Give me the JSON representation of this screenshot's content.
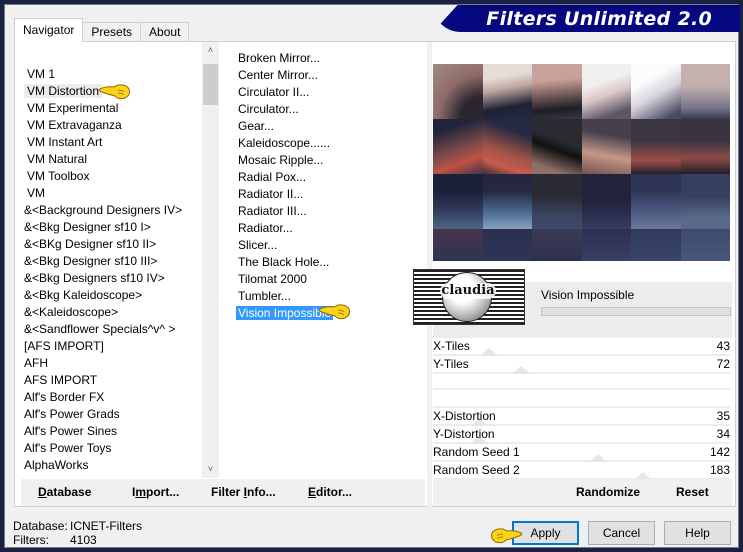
{
  "app": {
    "title": "Filters Unlimited 2.0"
  },
  "tabs": [
    {
      "label": "Navigator",
      "active": true
    },
    {
      "label": "Presets",
      "active": false
    },
    {
      "label": "About",
      "active": false
    }
  ],
  "categories": {
    "selected": "VM Distortion",
    "items": [
      "VM 1",
      "VM Distortion",
      "VM Experimental",
      "VM Extravaganza",
      "VM Instant Art",
      "VM Natural",
      "VM Toolbox",
      "VM",
      "&<Background Designers IV>",
      "&<Bkg Designer sf10 I>",
      "&<BKg Designer sf10 II>",
      "&<Bkg Designer sf10 III>",
      "&<Bkg Designers sf10 IV>",
      "&<Bkg Kaleidoscope>",
      "&<Kaleidoscope>",
      "&<Sandflower Specials^v^ >",
      "[AFS IMPORT]",
      "AFH",
      "AFS IMPORT",
      "Alf's Border FX",
      "Alf's Power Grads",
      "Alf's Power Sines",
      "Alf's Power Toys",
      "AlphaWorks"
    ]
  },
  "filters": {
    "selected": "Vision Impossible",
    "items": [
      "Broken Mirror...",
      "Center Mirror...",
      "Circulator II...",
      "Circulator...",
      "Gear...",
      "Kaleidoscope......",
      "Mosaic Ripple...",
      "Radial Pox...",
      "Radiator II...",
      "Radiator III...",
      "Radiator...",
      "Slicer...",
      "The Black Hole...",
      "Tilomat 2000",
      "Tumbler...",
      "Vision Impossible"
    ]
  },
  "filter_name": "Vision Impossible",
  "watermark": {
    "text": "claudia"
  },
  "parameters": [
    {
      "label": "X-Tiles",
      "value": 43
    },
    {
      "label": "Y-Tiles",
      "value": 72
    },
    null,
    {
      "label": "X-Distortion",
      "value": 35
    },
    {
      "label": "Y-Distortion",
      "value": 34
    },
    {
      "label": "Random Seed 1",
      "value": 142
    },
    {
      "label": "Random Seed 2",
      "value": 183
    }
  ],
  "left_actions": {
    "database": {
      "label": "Database",
      "mnemonic": "D"
    },
    "import": {
      "label": "Import...",
      "mnemonic": "m"
    },
    "filter_info": {
      "label": "Filter Info...",
      "mnemonic": "I"
    },
    "editor": {
      "label": "Editor...",
      "mnemonic": "E"
    }
  },
  "right_actions": {
    "randomize": "Randomize",
    "reset": "Reset"
  },
  "status": {
    "database_label": "Database:",
    "database_value": "ICNET-Filters",
    "filters_label": "Filters:",
    "filters_value": "4103"
  },
  "buttons": {
    "apply": "Apply",
    "cancel": "Cancel",
    "help": "Help"
  },
  "colors": {
    "frame": "#1a2145",
    "banner": "#05087e",
    "selection": "#3399ff",
    "default_button_border": "#0078d7"
  }
}
